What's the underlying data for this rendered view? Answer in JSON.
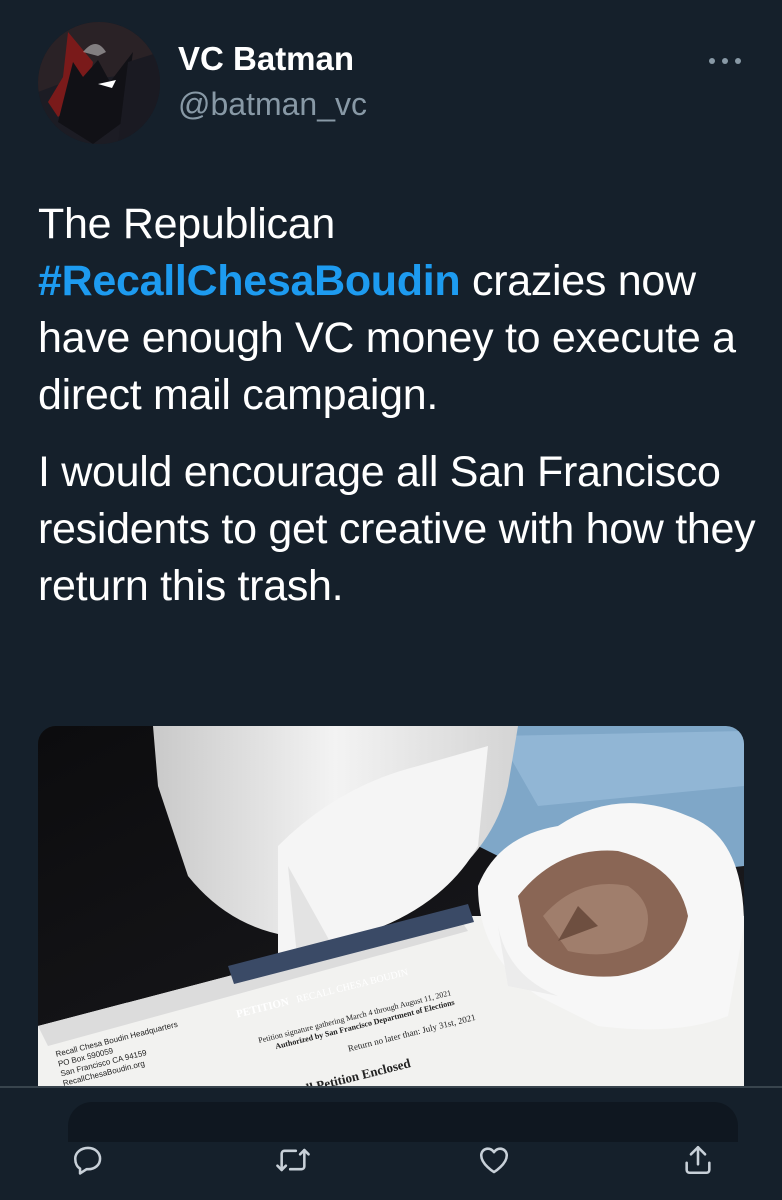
{
  "user": {
    "display_name": "VC Batman",
    "handle": "@batman_vc"
  },
  "tweet": {
    "line1_prefix": "The Republican",
    "hashtag": "#RecallChesaBoudin",
    "line2_suffix": " crazies now have enough VC money to execute a direct mail campaign.",
    "paragraph2": "I would encourage all San Francisco residents to get creative with how they return this trash."
  },
  "media": {
    "envelope": {
      "petition_tab": "PETITION",
      "recall_label": "RECALL CHESA BOUDIN",
      "gathering_text": "Petition signature gathering March 4 through August 11, 2021",
      "authorized_text": "Authorized by San Francisco Department of Elections",
      "return_text": "Return no later than: July 31st, 2021",
      "enclosed_text": "ll Petition Enclosed",
      "address_lines": [
        "Recall Chesa Boudin Headquarters",
        "PO Box 590059",
        "San Francisco CA 94159",
        "RecallChesaBoudin.org"
      ]
    }
  },
  "icons": {
    "more": "more-icon",
    "reply": "reply-icon",
    "retweet": "retweet-icon",
    "like": "like-icon",
    "share": "share-icon"
  },
  "colors": {
    "background": "#15202b",
    "accent": "#1d9bf0",
    "secondary_text": "#8899a6"
  }
}
